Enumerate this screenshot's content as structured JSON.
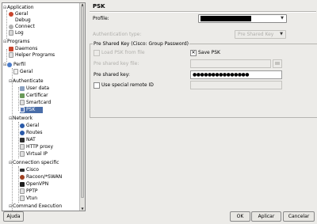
{
  "tree": {
    "items": [
      {
        "label": "Application",
        "icon": "collapse-toggle",
        "color": ""
      },
      {
        "label": "Geral",
        "icon": "red-gear-icon",
        "color": "#c8442c"
      },
      {
        "label": "Debug",
        "icon": "",
        "color": ""
      },
      {
        "label": "Connect",
        "icon": "connect-icon",
        "color": "#b0b0b0"
      },
      {
        "label": "Log",
        "icon": "log-icon",
        "color": "#d8d8d8"
      },
      {
        "label": "Programs",
        "icon": "collapse-toggle",
        "color": ""
      },
      {
        "label": "Daemons",
        "icon": "daemons-icon",
        "color": "#c8442c"
      },
      {
        "label": "Helper Programs",
        "icon": "helper-icon",
        "color": "#e0e0e0"
      },
      {
        "label": "Perfil",
        "icon": "perfil-icon",
        "color": "#4a7bc8"
      },
      {
        "label": "Geral",
        "icon": "document-icon",
        "color": "#f0f0f0"
      },
      {
        "label": "Authenticate",
        "icon": "collapse-toggle",
        "color": ""
      },
      {
        "label": "User data",
        "icon": "user-data-icon",
        "color": "#8aa0c0"
      },
      {
        "label": "Certificar",
        "icon": "certificate-icon",
        "color": "#6a9a5a"
      },
      {
        "label": "Smartcard",
        "icon": "smartcard-icon",
        "color": "#e0e0e0"
      },
      {
        "label": "PSK",
        "icon": "psk-icon",
        "color": "#5a7ab8"
      },
      {
        "label": "Network",
        "icon": "collapse-toggle",
        "color": ""
      },
      {
        "label": "Geral",
        "icon": "globe-icon",
        "color": "#2a5aa8"
      },
      {
        "label": "Routes",
        "icon": "routes-icon",
        "color": "#2a5aa8"
      },
      {
        "label": "NAT",
        "icon": "nat-icon",
        "color": "#303030"
      },
      {
        "label": "HTTP proxy",
        "icon": "proxy-icon",
        "color": "#e0e0e0"
      },
      {
        "label": "Virtual IP",
        "icon": "virtual-ip-icon",
        "color": "#e0e0e0"
      },
      {
        "label": "Connection specific",
        "icon": "collapse-toggle",
        "color": ""
      },
      {
        "label": "Cisco",
        "icon": "cisco-icon",
        "color": "#303030"
      },
      {
        "label": "Racoon/*SWAN",
        "icon": "racoon-icon",
        "color": "#a04020"
      },
      {
        "label": "OpenVPN",
        "icon": "openvpn-icon",
        "color": "#202020"
      },
      {
        "label": "PPTP",
        "icon": "pptp-icon",
        "color": "#e0e0e0"
      },
      {
        "label": "Vtun",
        "icon": "vtun-icon",
        "color": "#e0e0e0"
      },
      {
        "label": "Command Execution",
        "icon": "collapse-toggle",
        "color": ""
      }
    ]
  },
  "panel": {
    "title": "PSK",
    "profile_label": "Profile:",
    "auth_type_label": "Authentication type:",
    "auth_type_value": "Pre Shared Key",
    "group_title": "Pre Shared Key (Cisco: Group Password)",
    "load_psk_label": "Load PSK from file",
    "save_psk_label": "Save PSK",
    "psk_file_label": "Pre shared key file:",
    "psk_label": "Pre shared key:",
    "psk_value": "●●●●●●●●●●●●●●●",
    "remote_id_label": "Use special remote ID"
  },
  "buttons": {
    "help": "Ajuda",
    "ok": "OK",
    "apply": "Aplicar",
    "cancel": "Cancelar"
  }
}
